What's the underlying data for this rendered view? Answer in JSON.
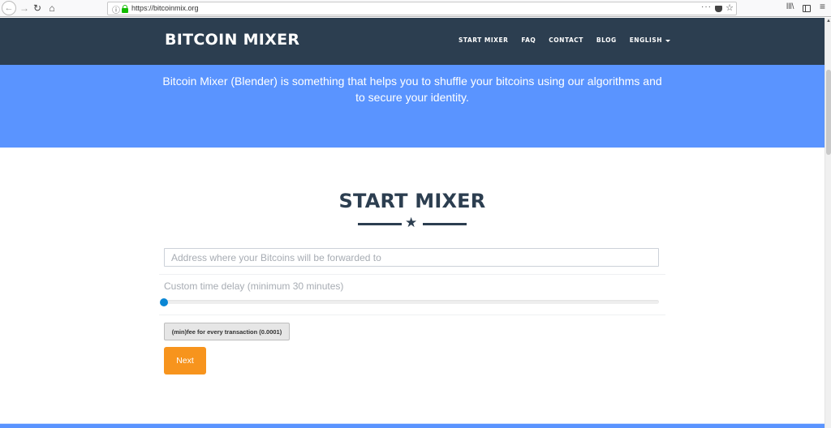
{
  "browser": {
    "url": "https://bitcoinmix.org",
    "icons": {
      "back": "arrow-left-icon",
      "forward": "arrow-right-icon",
      "reload": "reload-icon",
      "home": "home-icon",
      "info": "info-icon",
      "lock": "lock-icon",
      "more": "more-icon",
      "pocket": "pocket-icon",
      "bookmark": "star-icon",
      "library": "library-icon",
      "sidebar": "sidebar-icon",
      "menu": "hamburger-menu-icon"
    },
    "glyphs": {
      "back": "←",
      "forward": "→",
      "reload": "↻",
      "home": "⌂",
      "info": "ⓘ",
      "more": "···",
      "star": "☆",
      "library": "lll\\",
      "menu": "≡",
      "scroll_up": "▲"
    }
  },
  "navbar": {
    "brand": "BITCOIN MIXER",
    "links": [
      {
        "label": "START MIXER"
      },
      {
        "label": "FAQ"
      },
      {
        "label": "CONTACT"
      },
      {
        "label": "BLOG"
      },
      {
        "label": "ENGLISH",
        "dropdown": true
      }
    ]
  },
  "hero": {
    "text": "Bitcoin Mixer (Blender) is something that helps you to shuffle your bitcoins using our algorithms and to secure your identity."
  },
  "mixer": {
    "title": "START MIXER",
    "divider_glyph": "★",
    "address_input": {
      "placeholder": "Address where your Bitcoins will be forwarded to",
      "value": ""
    },
    "delay_label": "Custom time delay (minimum 30 minutes)",
    "delay_slider": {
      "value_fraction": 0
    },
    "fee_button": "(min)fee for every transaction (0.0001)",
    "next_button": "Next"
  },
  "colors": {
    "navbar_bg": "#2c3e50",
    "hero_bg": "#5a94ff",
    "accent_orange": "#f7941d",
    "slider_thumb": "#0a86d4",
    "title_color": "#2c3e50"
  }
}
